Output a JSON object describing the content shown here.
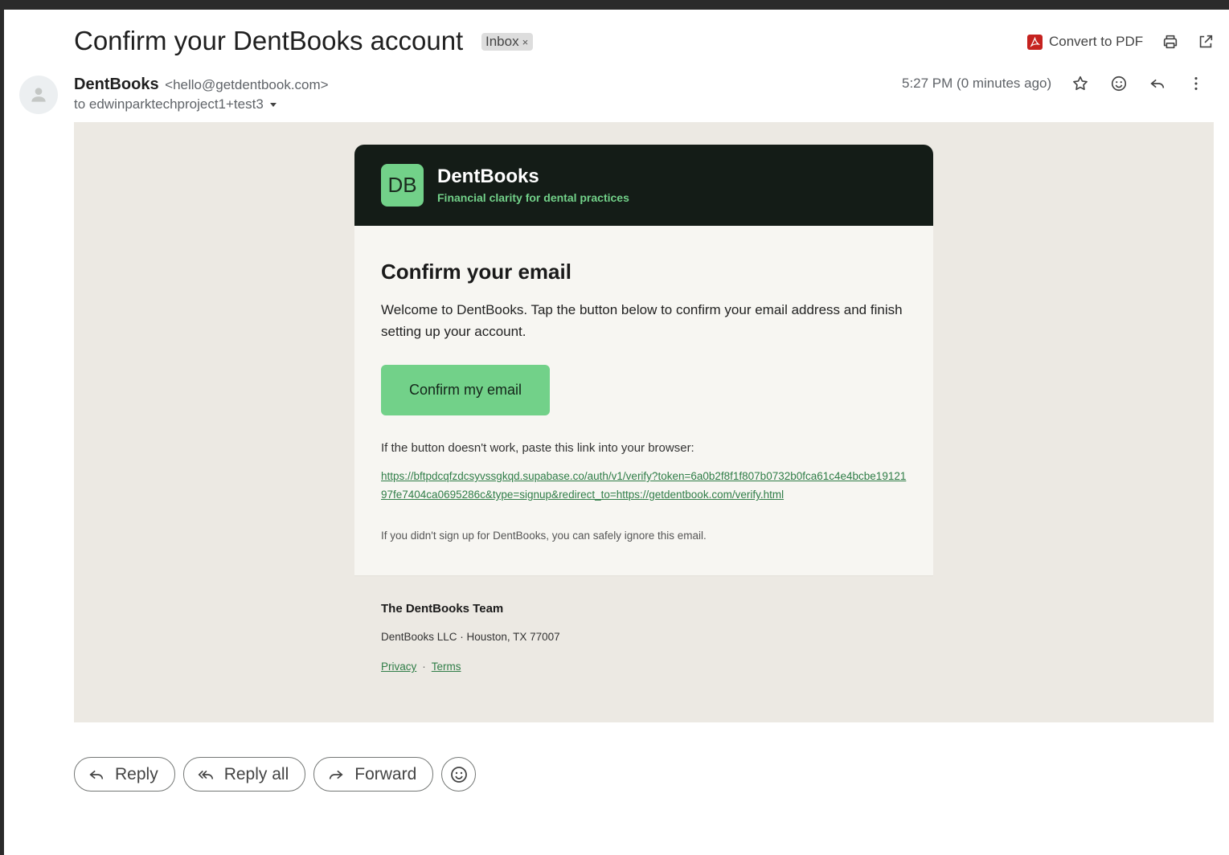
{
  "email": {
    "subject": "Confirm your DentBooks account",
    "label": "Inbox",
    "label_close": "×",
    "convert_pdf": "Convert to PDF",
    "sender_name": "DentBooks",
    "sender_email": "<hello@getdentbook.com>",
    "recipient": "to edwinparktechproject1+test3",
    "time": "5:27 PM (0 minutes ago)"
  },
  "message": {
    "logo_text": "DB",
    "brand_name": "DentBooks",
    "brand_tagline": "Financial clarity for dental practices",
    "heading": "Confirm your email",
    "intro": "Welcome to DentBooks. Tap the button below to confirm your email address and finish setting up your account.",
    "cta": "Confirm my email",
    "fallback": "If the button doesn't work, paste this link into your browser:",
    "link": "https://bftpdcqfzdcsyvssgkqd.supabase.co/auth/v1/verify?token=6a0b2f8f1f807b0732b0fca61c4e4bcbe1912197fe7404ca0695286c&type=signup&redirect_to=https://getdentbook.com/verify.html",
    "ignore": "If you didn't sign up for DentBooks, you can safely ignore this email.",
    "team": "The DentBooks Team",
    "address": "DentBooks LLC · Houston, TX 77007",
    "privacy": "Privacy",
    "separator": "·",
    "terms": "Terms"
  },
  "actions": {
    "reply": "Reply",
    "reply_all": "Reply all",
    "forward": "Forward"
  },
  "icons": [
    "pdf-icon",
    "print-icon",
    "open-new-window-icon",
    "star-icon",
    "emoji-icon",
    "reply-icon",
    "more-vert-icon",
    "avatar-icon",
    "dropdown-icon",
    "reply-all-icon",
    "forward-icon"
  ],
  "colors": {
    "brand_green": "#72d189",
    "header_dark": "#141c17",
    "link_green": "#2f7d47",
    "frame_bg": "#ece9e3"
  }
}
